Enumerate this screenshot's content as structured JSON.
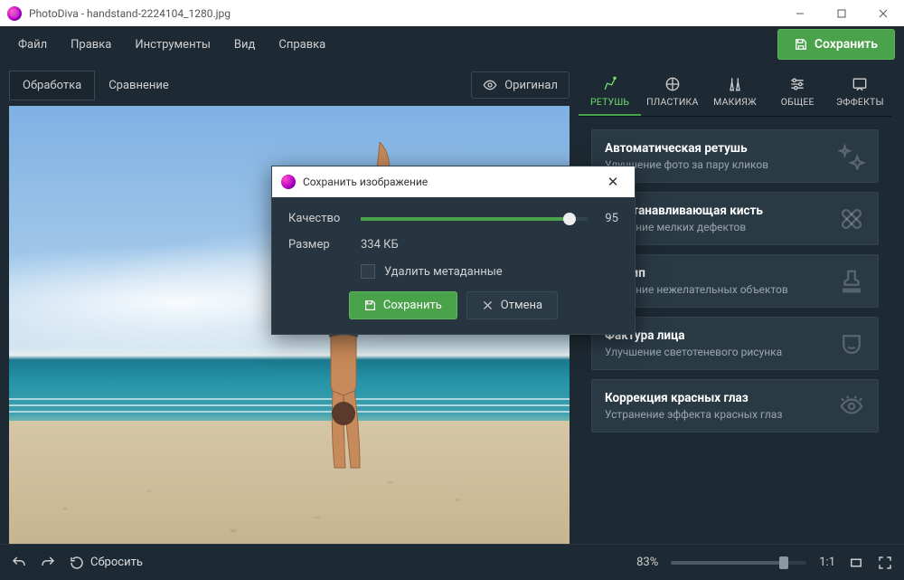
{
  "window": {
    "title": "PhotoDiva - handstand-2224104_1280.jpg"
  },
  "menu": {
    "file": "Файл",
    "edit": "Правка",
    "tools": "Инструменты",
    "view": "Вид",
    "help": "Справка"
  },
  "save_button": "Сохранить",
  "tabs": {
    "process": "Обработка",
    "compare": "Сравнение",
    "original": "Оригинал"
  },
  "tool_tabs": [
    {
      "id": "retouch",
      "label": "РЕТУШЬ"
    },
    {
      "id": "plastic",
      "label": "ПЛАСТИКА"
    },
    {
      "id": "makeup",
      "label": "МАКИЯЖ"
    },
    {
      "id": "general",
      "label": "ОБЩЕЕ"
    },
    {
      "id": "effects",
      "label": "ЭФФЕКТЫ"
    }
  ],
  "cards": [
    {
      "title": "Автоматическая ретушь",
      "sub": "Улучшение фото за пару кликов"
    },
    {
      "title": "Восстанавливающая кисть",
      "sub": "Удаление мелких дефектов"
    },
    {
      "title": "Штамп",
      "sub": "Удаление нежелательных объектов"
    },
    {
      "title": "Фактура лица",
      "sub": "Улучшение светотеневого рисунка"
    },
    {
      "title": "Коррекция красных глаз",
      "sub": "Устранение эффекта красных глаз"
    }
  ],
  "status": {
    "reset": "Сбросить",
    "zoom_pct": "83%",
    "zoom_one": "1:1"
  },
  "modal": {
    "title": "Сохранить изображение",
    "quality_label": "Качество",
    "quality_value": "95",
    "size_label": "Размер",
    "size_value": "334 КБ",
    "strip_meta_label": "Удалить метаданные",
    "save": "Сохранить",
    "cancel": "Отмена"
  }
}
